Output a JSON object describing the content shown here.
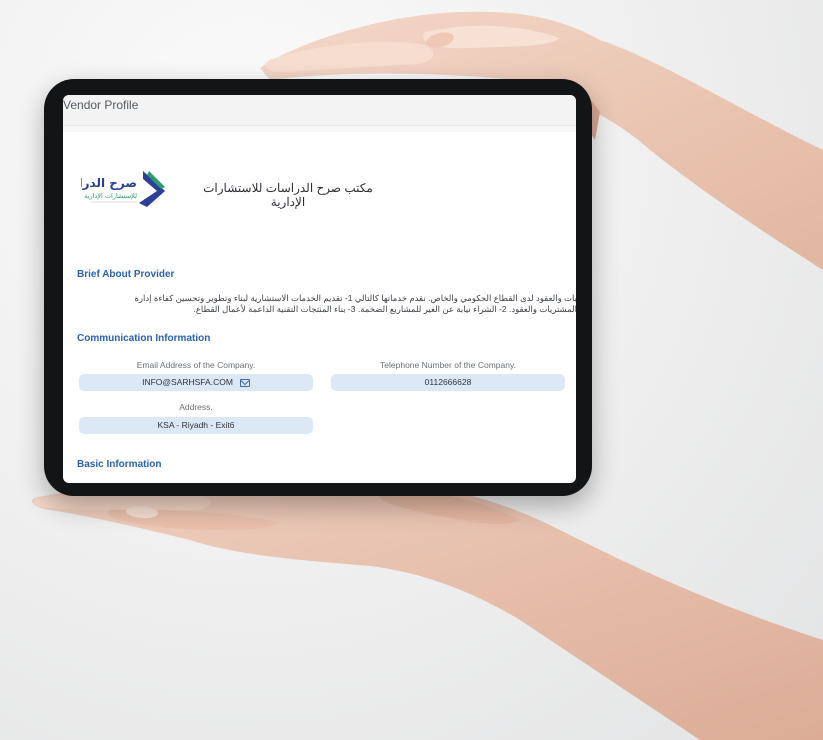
{
  "window": {
    "title": "Vendor Profile"
  },
  "provider": {
    "logo_text_main": "صرح الدراسات",
    "logo_text_sub": "للإستشارات الإدارية",
    "name": "مكتب صرح الدراسات للاستشارات الإدارية"
  },
  "sections": {
    "brief_title": "Brief About Provider",
    "communication_title": "Communication Information",
    "basic_title": "Basic Information"
  },
  "brief": {
    "line1": "يات والعقود لدى القطاع الحكومي والخاص. نقدم خدماتها كالتالي 1- تقديم الخدمات الاستشارية لبناء وتطوير وتحسين كفاءة إدارة",
    "line2": "المشتريات والعقود. 2- الشراء نيابة عن الغير للمشاريع الضخمة. 3- بناء المنتجات التقنية الداعمة لأعمال القطاع."
  },
  "communication": {
    "email_label": "Email Address of the Company.",
    "email_value": "INFO@SARHSFA.COM",
    "phone_label": "Telephone Number of the Company.",
    "phone_value": "0112666628",
    "address_label": "Address.",
    "address_value": "KSA - Riyadh - Exit6"
  },
  "icons": {
    "email": "mail-icon"
  },
  "colors": {
    "section_title": "#2a62b0",
    "field_background": "#dde8f7",
    "logo_blue": "#2a3f96",
    "logo_green": "#2f9b68",
    "tablet_frame": "#131415"
  }
}
